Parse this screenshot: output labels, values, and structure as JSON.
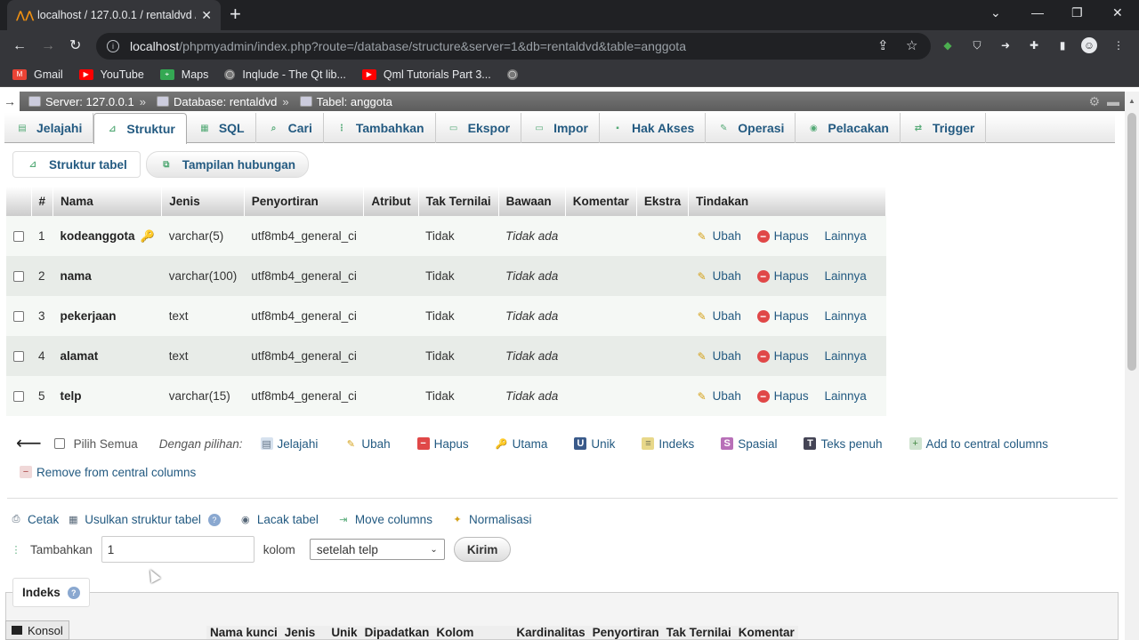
{
  "browser": {
    "tab_title": "localhost / 127.0.0.1 / rentaldvd /",
    "url_host": "localhost",
    "url_path": "/phpmyadmin/index.php?route=/database/structure&server=1&db=rentaldvd&table=anggota",
    "bookmarks": [
      {
        "label": "Gmail",
        "color": "#ea4335"
      },
      {
        "label": "YouTube",
        "color": "#ff0000"
      },
      {
        "label": "Maps",
        "color": "#34a853"
      },
      {
        "label": "Inqlude - The Qt lib...",
        "color": "#888888"
      },
      {
        "label": "Qml Tutorials Part 3...",
        "color": "#ff0000"
      }
    ]
  },
  "breadcrumb": {
    "server": "Server: 127.0.0.1",
    "database": "Database: rentaldvd",
    "table": "Tabel: anggota"
  },
  "tabs": [
    "Jelajahi",
    "Struktur",
    "SQL",
    "Cari",
    "Tambahkan",
    "Ekspor",
    "Impor",
    "Hak Akses",
    "Operasi",
    "Pelacakan",
    "Trigger"
  ],
  "subtabs": [
    "Struktur tabel",
    "Tampilan hubungan"
  ],
  "table": {
    "headers": [
      "#",
      "Nama",
      "Jenis",
      "Penyortiran",
      "Atribut",
      "Tak Ternilai",
      "Bawaan",
      "Komentar",
      "Ekstra",
      "Tindakan"
    ],
    "rows": [
      {
        "num": "1",
        "name": "kodeanggota",
        "type": "varchar(5)",
        "collation": "utf8mb4_general_ci",
        "null": "Tidak",
        "default": "Tidak ada",
        "key": true
      },
      {
        "num": "2",
        "name": "nama",
        "type": "varchar(100)",
        "collation": "utf8mb4_general_ci",
        "null": "Tidak",
        "default": "Tidak ada",
        "key": false
      },
      {
        "num": "3",
        "name": "pekerjaan",
        "type": "text",
        "collation": "utf8mb4_general_ci",
        "null": "Tidak",
        "default": "Tidak ada",
        "key": false
      },
      {
        "num": "4",
        "name": "alamat",
        "type": "text",
        "collation": "utf8mb4_general_ci",
        "null": "Tidak",
        "default": "Tidak ada",
        "key": false
      },
      {
        "num": "5",
        "name": "telp",
        "type": "varchar(15)",
        "collation": "utf8mb4_general_ci",
        "null": "Tidak",
        "default": "Tidak ada",
        "key": false
      }
    ],
    "actions": {
      "edit": "Ubah",
      "drop": "Hapus",
      "more": "Lainnya"
    }
  },
  "bulk": {
    "check_all": "Pilih Semua",
    "with_selected": "Dengan pilihan:",
    "actions": [
      "Jelajahi",
      "Ubah",
      "Hapus",
      "Utama",
      "Unik",
      "Indeks",
      "Spasial",
      "Teks penuh",
      "Add to central columns",
      "Remove from central columns"
    ]
  },
  "tools": {
    "print": "Cetak",
    "propose": "Usulkan struktur tabel",
    "track": "Lacak tabel",
    "move": "Move columns",
    "normalize": "Normalisasi"
  },
  "add_columns": {
    "label": "Tambahkan",
    "value": "1",
    "unit": "kolom",
    "position": "setelah telp",
    "submit": "Kirim"
  },
  "indexes": {
    "title": "Indeks",
    "headers": [
      "Nama kunci",
      "Jenis",
      "Unik",
      "Dipadatkan",
      "Kolom",
      "Kardinalitas",
      "Penyortiran",
      "Tak Ternilai",
      "Komentar"
    ]
  },
  "console": "Konsol"
}
